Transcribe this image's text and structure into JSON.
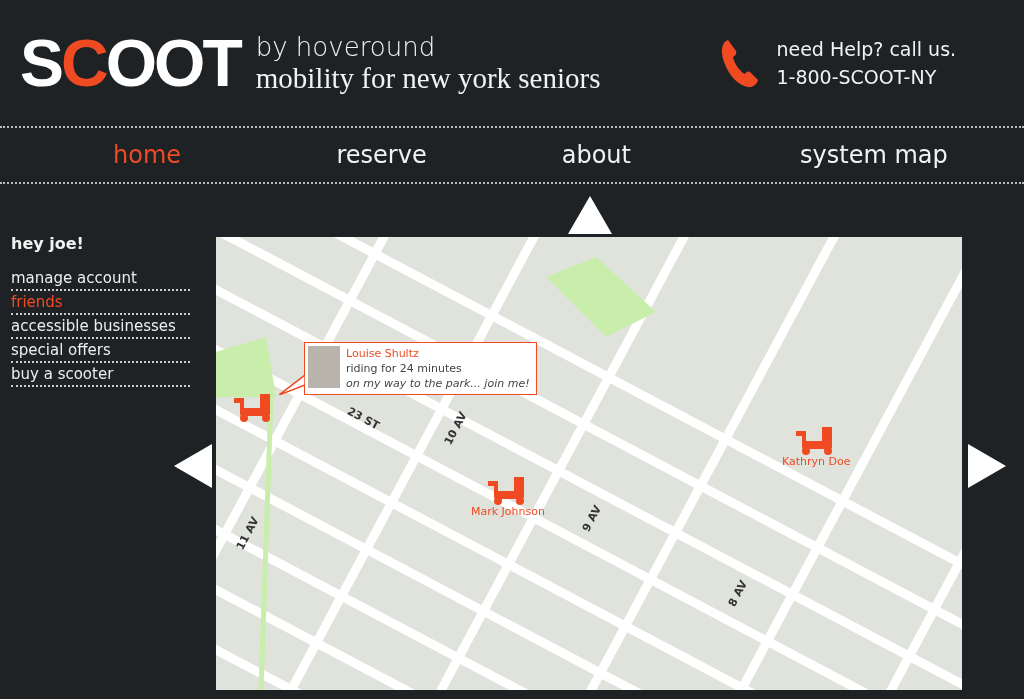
{
  "header": {
    "logo": "SCOOT",
    "tagline": "by hoveround",
    "subtitle": "mobility for new york seniors",
    "help": "need Help?  call us.",
    "phone": "1-800-SCOOT-NY"
  },
  "nav": [
    {
      "label": "home",
      "selected": true
    },
    {
      "label": "reserve",
      "selected": false
    },
    {
      "label": "about",
      "selected": false
    },
    {
      "label": "system map",
      "selected": false
    }
  ],
  "sidebar": {
    "greeting": "hey joe!",
    "items": [
      {
        "label": "manage account",
        "selected": false
      },
      {
        "label": "friends",
        "selected": true
      },
      {
        "label": "accessible businesses",
        "selected": false
      },
      {
        "label": "special offers",
        "selected": false
      },
      {
        "label": "buy a scooter",
        "selected": false
      }
    ]
  },
  "map": {
    "streets": [
      "23 ST",
      "10 AV",
      "11 AV",
      "9 AV",
      "8 AV"
    ],
    "riders": [
      {
        "name": "Mark Johnson"
      },
      {
        "name": "Kathryn Doe"
      }
    ],
    "popup": {
      "name": "Louise Shultz",
      "status": "riding for 24 minutes",
      "message": "on my way to the park... join me!"
    }
  }
}
